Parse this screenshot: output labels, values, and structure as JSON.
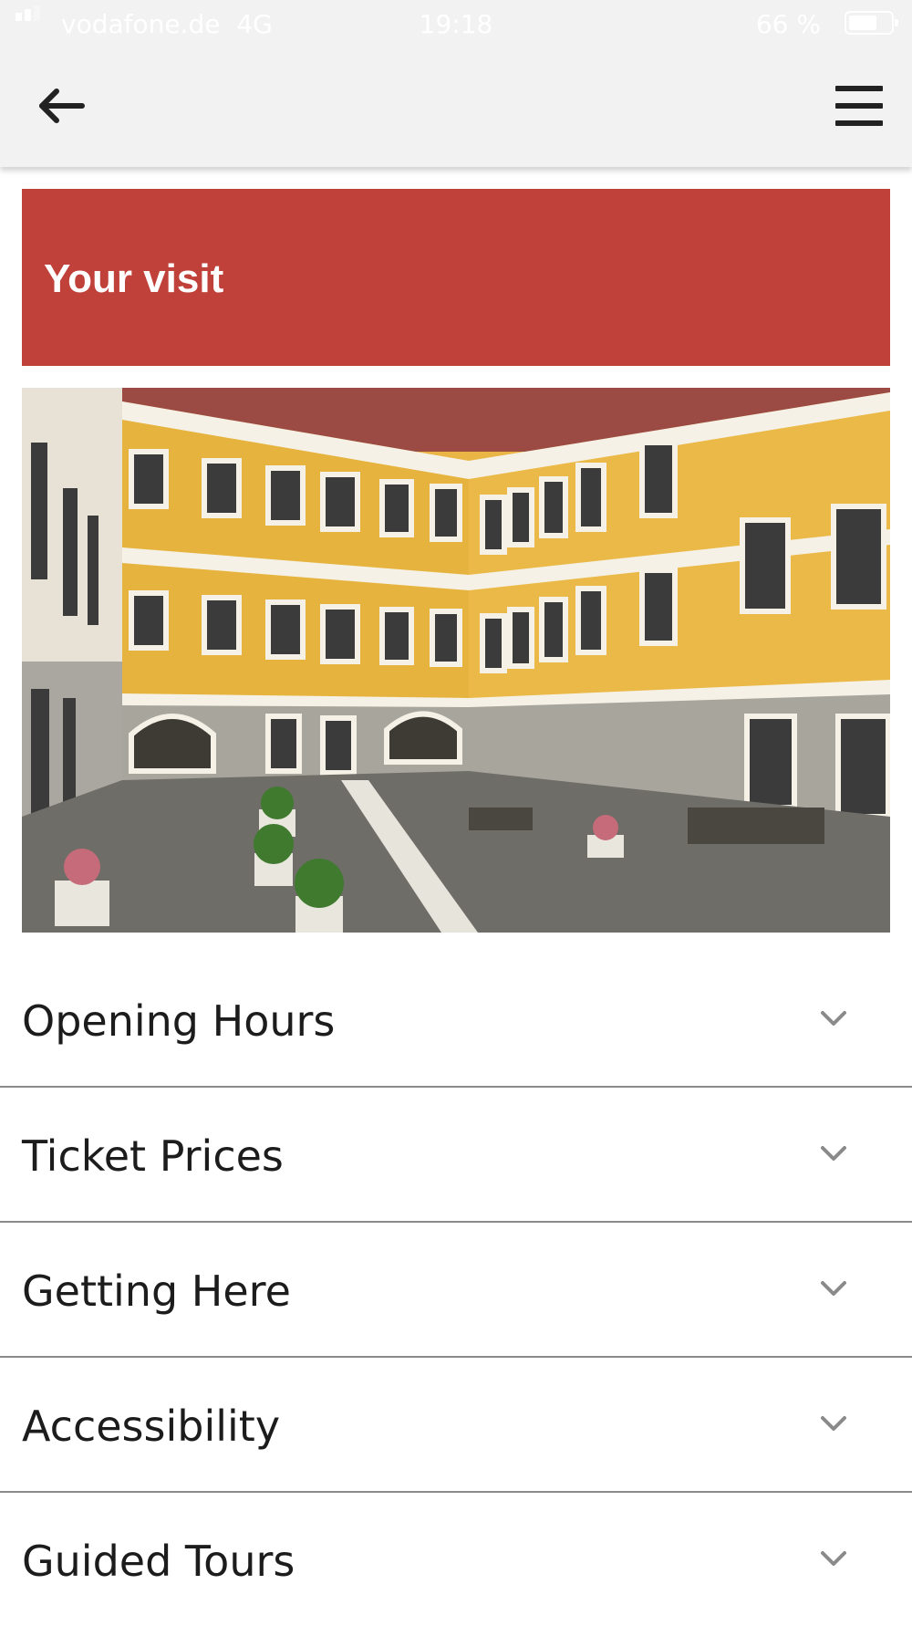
{
  "status_bar": {
    "carrier": "vodafone.de",
    "network": "4G",
    "time": "19:18",
    "battery_percent": "66 %"
  },
  "nav": {
    "back_icon": "arrow-left-icon",
    "menu_icon": "hamburger-menu-icon"
  },
  "page": {
    "title": "Your visit",
    "banner_color": "#c0403a"
  },
  "hero_image": {
    "alt": "courtyard-photo"
  },
  "accordion": {
    "items": [
      {
        "label": "Opening Hours"
      },
      {
        "label": "Ticket Prices"
      },
      {
        "label": "Getting Here"
      },
      {
        "label": "Accessibility"
      },
      {
        "label": "Guided Tours"
      }
    ],
    "chevron_icon": "chevron-down-icon"
  }
}
